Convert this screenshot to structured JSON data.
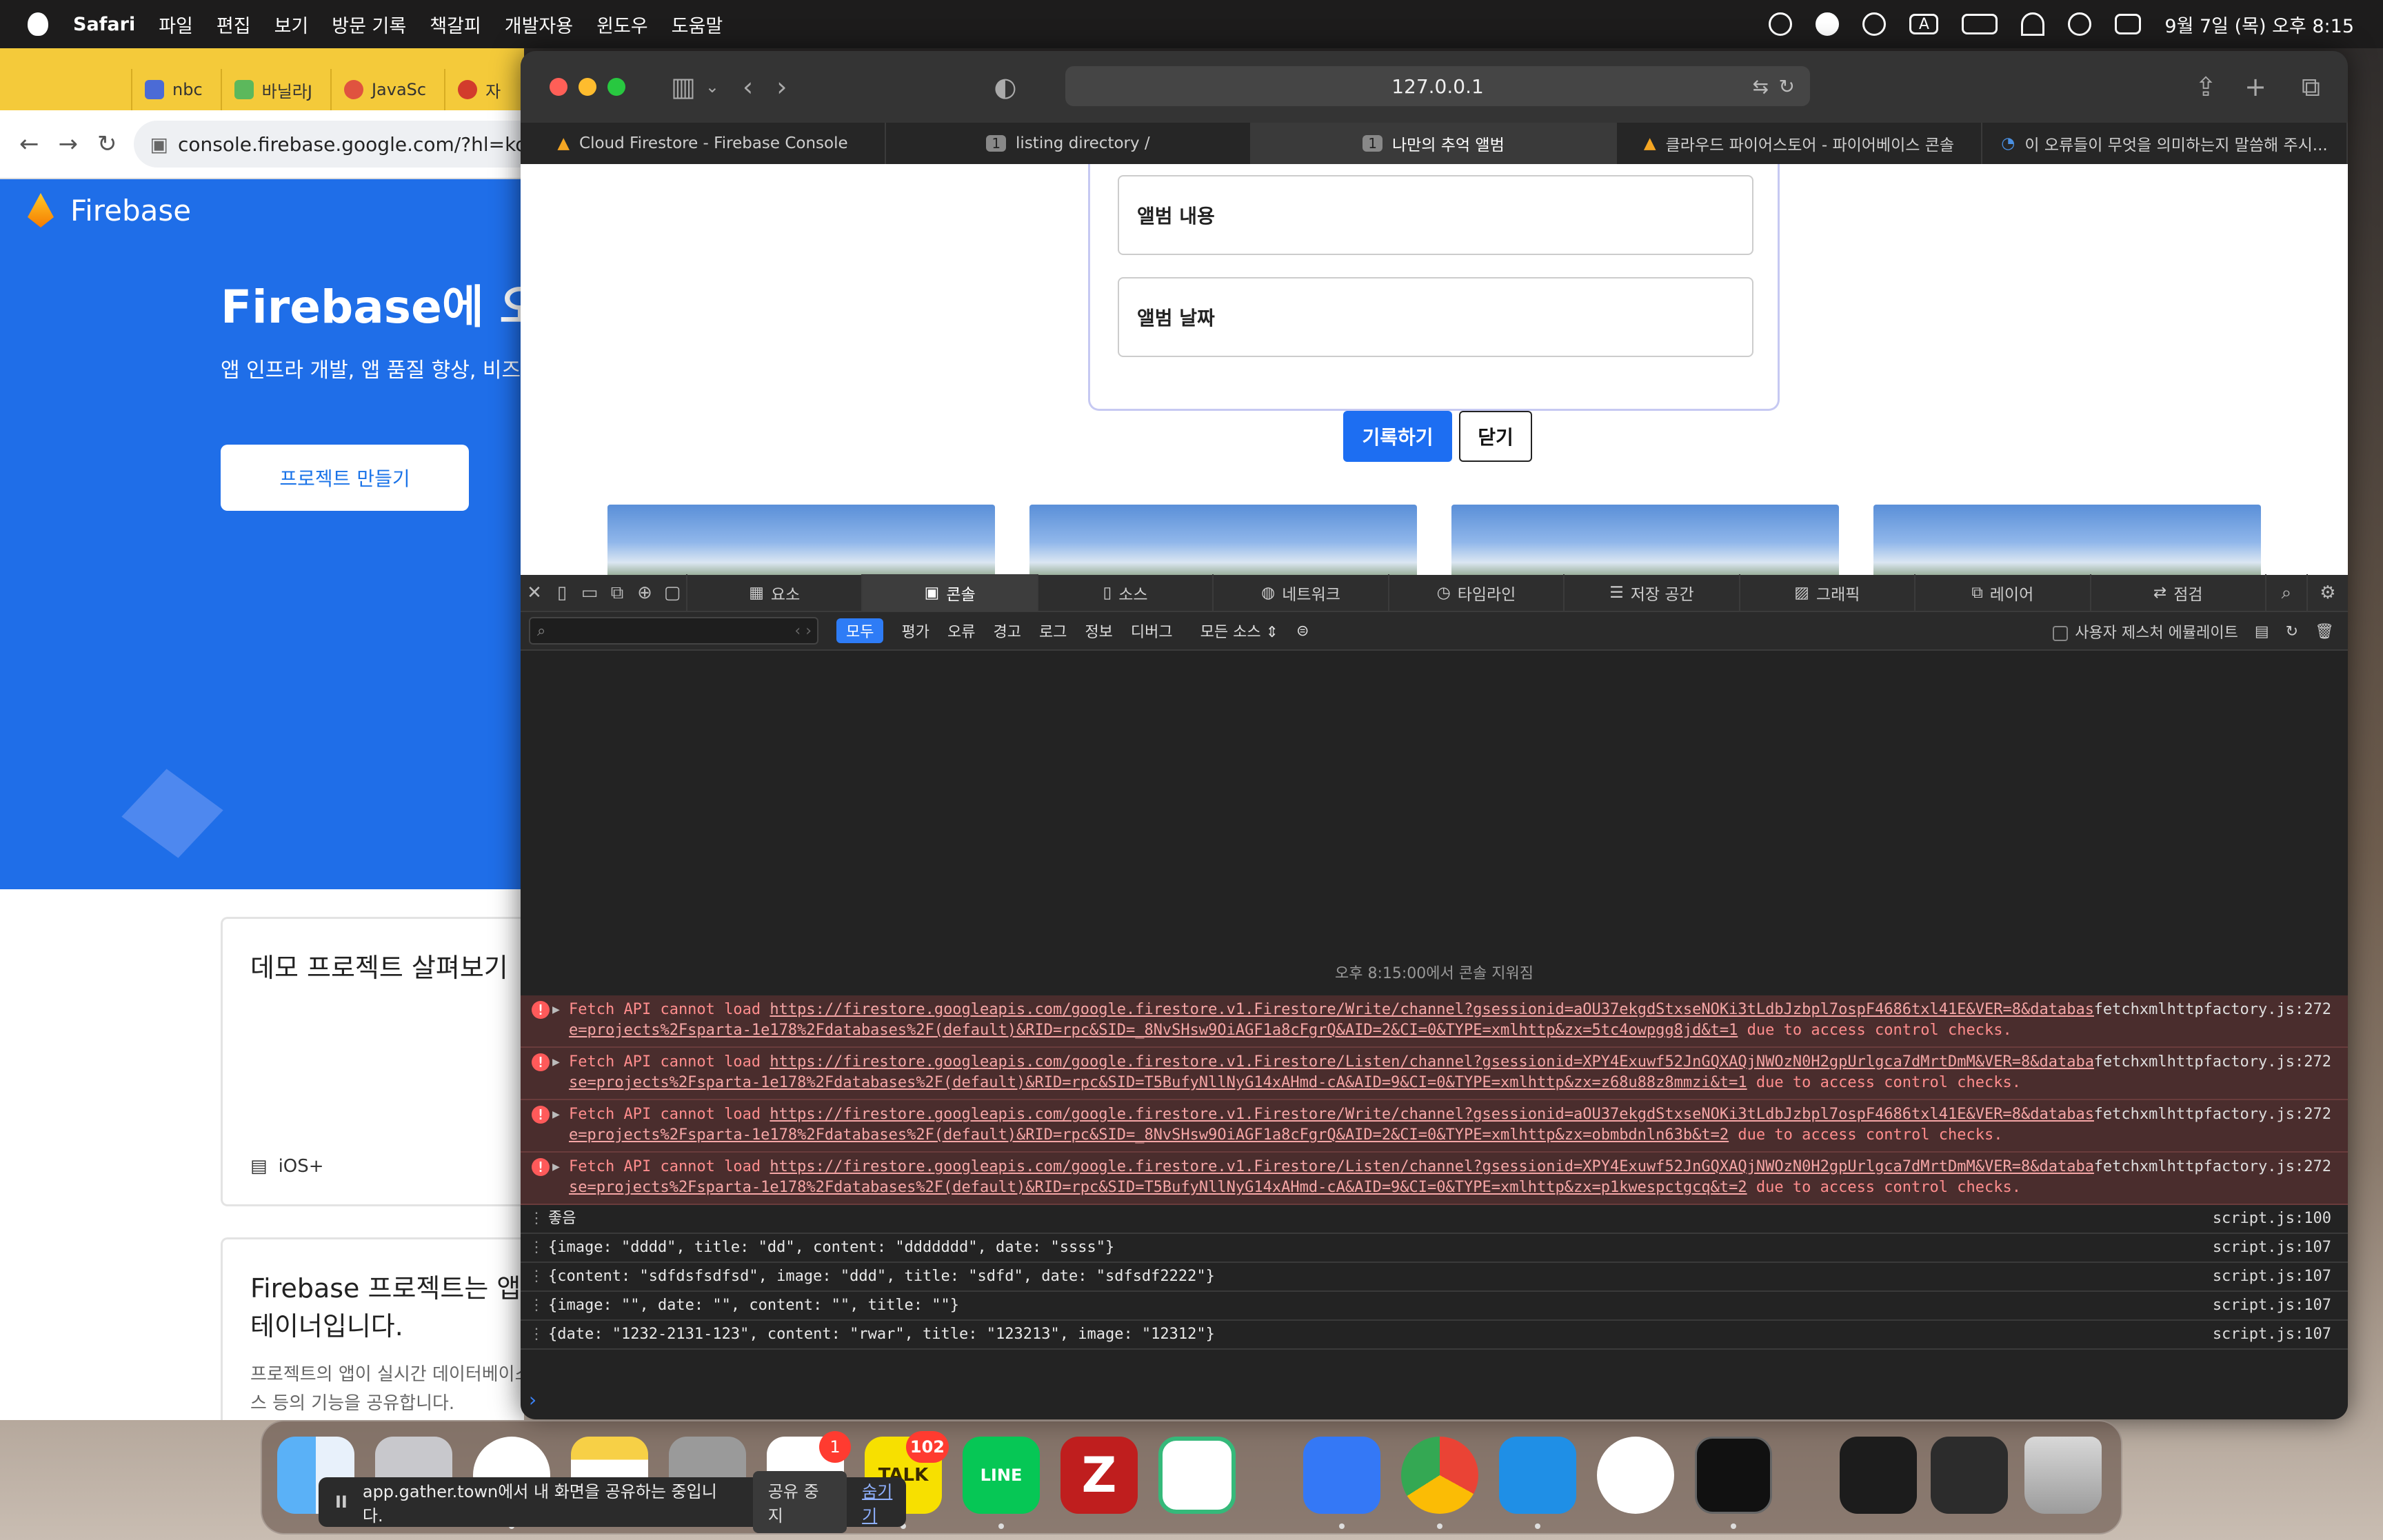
{
  "menubar": {
    "app": "Safari",
    "items": [
      "파일",
      "편집",
      "보기",
      "방문 기록",
      "책갈피",
      "개발자용",
      "윈도우",
      "도움말"
    ],
    "clock": "9월 7일 (목) 오후 8:15",
    "input_indicator": "A"
  },
  "chrome": {
    "tabs": [
      "nbc",
      "바닐라J",
      "JavaSc",
      "자"
    ],
    "url": "console.firebase.google.com/?hl=ko",
    "brand": "Firebase",
    "headline": "Firebase에 오",
    "subline": "앱 인프라 개발, 앱 품질 향상, 비즈니",
    "create_button": "프로젝트 만들기",
    "card1_title": "데모 프로젝트 살펴보기",
    "card1_platform": "iOS+",
    "card2_title_line1": "Firebase 프로젝트는 앱을",
    "card2_title_line2": "테이너입니다.",
    "card2_sub_line1": "프로젝트의 앱이 실시간 데이터베이스",
    "card2_sub_line2": "스 등의 기능을 공유합니다."
  },
  "safari": {
    "address": "127.0.0.1",
    "tabs": [
      {
        "label": "Cloud Firestore - Firebase Console",
        "num": ""
      },
      {
        "label": "listing directory /",
        "num": "1"
      },
      {
        "label": "나만의 추억 앨범",
        "num": "1"
      },
      {
        "label": "클라우드 파이어스토어 - 파이어베이스 콘솔",
        "num": ""
      },
      {
        "label": "이 오류들이 무엇을 의미하는지 말씀해 주시...",
        "num": ""
      }
    ]
  },
  "page": {
    "content_field": "앨범 내용",
    "date_field": "앨범 날짜",
    "submit_button": "기록하기",
    "close_button": "닫기"
  },
  "devtools": {
    "tabs": [
      "요소",
      "콘솔",
      "소스",
      "네트워크",
      "타임라인",
      "저장 공간",
      "그래픽",
      "레이어",
      "점검"
    ],
    "levels": [
      "모두",
      "평가",
      "오류",
      "경고",
      "로그",
      "정보",
      "디버그"
    ],
    "sources_filter": "모든 소스",
    "gesture_emulation": "사용자 제스처 에뮬레이트",
    "cleared_message": "오후 8:15:00에서 콘솔 지워짐",
    "errors": [
      {
        "prefix": "Fetch API cannot load ",
        "url": "https://firestore.googleapis.com/google.firestore.v1.Firestore/Write/channel?gsessionid=aOU37ekgdStxseNOKi3tLdbJzbpl7ospF4686txl41E&VER=8&database=projects%2Fsparta-1e178%2Fdatabases%2F(default)&RID=rpc&SID=_8NvSHsw9OiAGF1a8cFgrQ&AID=2&CI=0&TYPE=xmlhttp&zx=5tc4owpgg8jd&t=1",
        "suffix": " due to access control checks.",
        "source": "fetchxmlhttpfactory.js:272"
      },
      {
        "prefix": "Fetch API cannot load ",
        "url": "https://firestore.googleapis.com/google.firestore.v1.Firestore/Listen/channel?gsessionid=XPY4Exuwf52JnGQXAQjNWOzN0H2gpUrlgca7dMrtDmM&VER=8&database=projects%2Fsparta-1e178%2Fdatabases%2F(default)&RID=rpc&SID=T5BufyNllNyG14xAHmd-cA&AID=9&CI=0&TYPE=xmlhttp&zx=z68u88z8mmzi&t=1",
        "suffix": " due to access control checks.",
        "source": "fetchxmlhttpfactory.js:272"
      },
      {
        "prefix": "Fetch API cannot load ",
        "url": "https://firestore.googleapis.com/google.firestore.v1.Firestore/Write/channel?gsessionid=aOU37ekgdStxseNOKi3tLdbJzbpl7ospF4686txl41E&VER=8&database=projects%2Fsparta-1e178%2Fdatabases%2F(default)&RID=rpc&SID=_8NvSHsw9OiAGF1a8cFgrQ&AID=2&CI=0&TYPE=xmlhttp&zx=obmbdnln63b&t=2",
        "suffix": " due to access control checks.",
        "source": "fetchxmlhttpfactory.js:272"
      },
      {
        "prefix": "Fetch API cannot load ",
        "url": "https://firestore.googleapis.com/google.firestore.v1.Firestore/Listen/channel?gsessionid=XPY4Exuwf52JnGQXAQjNWOzN0H2gpUrlgca7dMrtDmM&VER=8&database=projects%2Fsparta-1e178%2Fdatabases%2F(default)&RID=rpc&SID=T5BufyNllNyG14xAHmd-cA&AID=9&CI=0&TYPE=xmlhttp&zx=p1kwespctgcq&t=2",
        "suffix": " due to access control checks.",
        "source": "fetchxmlhttpfactory.js:272"
      }
    ],
    "logs": [
      {
        "text": "좋음",
        "source": "script.js:100"
      },
      {
        "text": "{image: \"dddd\", title: \"dd\", content: \"ddddddd\", date: \"ssss\"}",
        "source": "script.js:107"
      },
      {
        "text": "{content: \"sdfdsfsdfsd\", image: \"ddd\", title: \"sdfd\", date: \"sdfsdf2222\"}",
        "source": "script.js:107"
      },
      {
        "text": "{image: \"\", date: \"\", content: \"\", title: \"\"}",
        "source": "script.js:107"
      },
      {
        "text": "{date: \"1232-2131-123\", content: \"rwar\", title: \"123213\", image: \"12312\"}",
        "source": "script.js:107"
      }
    ]
  },
  "dock": {
    "slack_badge": "1",
    "talk_badge": "102",
    "talk_label": "TALK",
    "line_label": "LINE"
  },
  "sharebar": {
    "message": "app.gather.town에서 내 화면을 공유하는 중입니다.",
    "stop": "공유 중지",
    "hide": "숨기기"
  },
  "colors": {
    "firebase_blue": "#1f6ee8",
    "submit_blue": "#1d6ef2",
    "error_bg": "#4a2d2d",
    "error_text": "#ff8d8d"
  }
}
